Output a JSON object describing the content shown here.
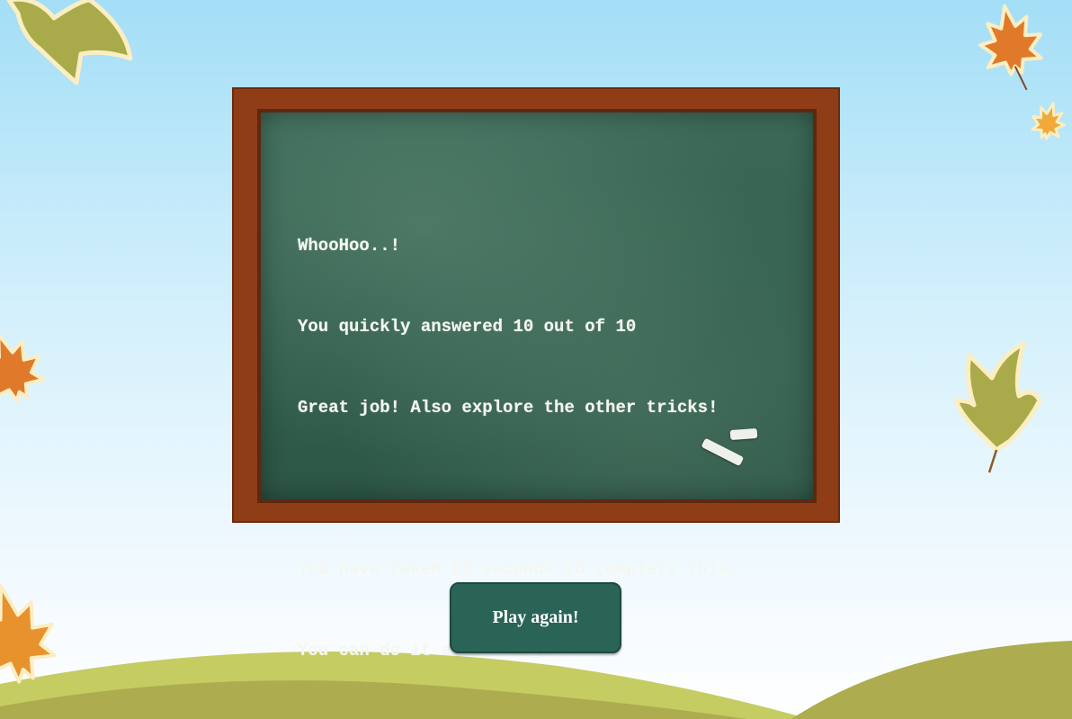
{
  "board": {
    "lines": [
      "WhooHoo..!",
      "You quickly answered 10 out of 10",
      "Great job! Also explore the other tricks!",
      "",
      "You have taken 63 seconds to complete this.",
      "You can do it a lot faster!"
    ]
  },
  "play_button": {
    "label": "Play again!"
  },
  "colors": {
    "board_green": "#335f4e",
    "frame_wood": "#8e3d17",
    "button_green": "#2a6456",
    "hill_light": "#c5cc62",
    "hill_dark": "#adac4f",
    "leaf_orange": "#e08a33",
    "leaf_olive": "#a9ab4b"
  },
  "icons": {
    "leaf_top_left": "olive-leaf-icon",
    "leaf_top_right": "maple-leaf-icon",
    "leaf_small_right": "maple-leaf-icon",
    "leaf_mid_left": "maple-leaf-icon",
    "leaf_mid_right": "olive-leaf-icon",
    "leaf_bottom_left": "maple-leaf-icon"
  }
}
